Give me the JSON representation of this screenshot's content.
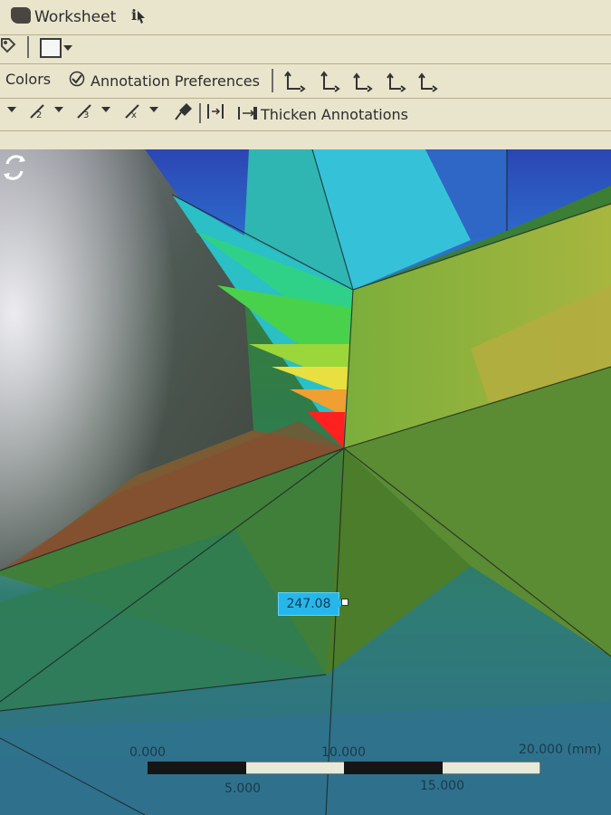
{
  "toolbar": {
    "worksheet_label": "Worksheet",
    "colors_label": "Colors",
    "annotation_preferences_label": "Annotation Preferences",
    "thicken_annotations_label": "Thicken Annotations"
  },
  "probe": {
    "value": "247.08"
  },
  "scale": {
    "label_0": "0.000",
    "label_5": "5.000",
    "label_10": "10.000",
    "label_15": "15.000",
    "label_20": "20.000 (mm)"
  },
  "icons": [
    "worksheet-icon",
    "info-probe-icon",
    "tag-icon",
    "display-box-icon",
    "annotation-check-icon",
    "axis-tool-icon",
    "label-tool-icon",
    "pin-icon",
    "align-icon",
    "thicken-icon",
    "rotate-icon"
  ],
  "colors": {
    "toolbar_bg": "#e9e4cc",
    "probe_bg": "#27b6ea",
    "contour_red": "#ff2020",
    "contour_yellow": "#e8e040",
    "contour_green": "#2fcf52",
    "contour_cyan": "#32c2d8",
    "contour_blue": "#2f67c6"
  }
}
